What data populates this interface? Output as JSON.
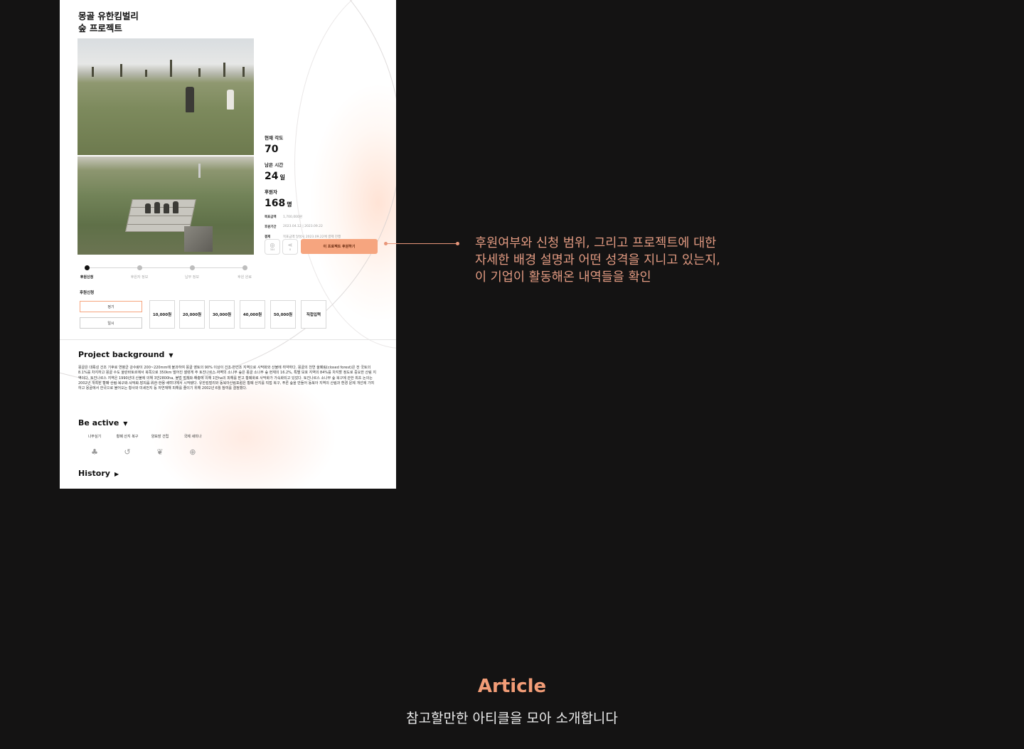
{
  "project": {
    "title_line1": "몽골 유한킴벌리",
    "title_line2": "숲 프로젝트"
  },
  "stats": [
    {
      "label": "현재 각도",
      "value": "70",
      "unit": ""
    },
    {
      "label": "남은 시간",
      "value": "24",
      "unit": "일"
    },
    {
      "label": "후원자",
      "value": "168",
      "unit": "명"
    }
  ],
  "info": [
    {
      "label": "목표금액",
      "value": "1,700,000원"
    },
    {
      "label": "후원기간",
      "value": "2023.04.12 | 2023.09.22"
    },
    {
      "label": "결제",
      "value": "목표금액 달성시 2023.09.22에 결제 진행"
    }
  ],
  "actions": {
    "like_count": "384",
    "share_count": "8",
    "support_button": "이 프로젝트 후원하기"
  },
  "steps": [
    {
      "label": "후원신청",
      "active": true
    },
    {
      "label": "후원자 정보",
      "active": false
    },
    {
      "label": "납부 정보",
      "active": false
    },
    {
      "label": "후원 완료",
      "active": false
    }
  ],
  "form": {
    "section_label": "후원신청",
    "types": [
      "정기",
      "일시"
    ],
    "amounts": [
      "10,000원",
      "20,000원",
      "30,000원",
      "40,000원",
      "50,000원",
      "직접입력"
    ]
  },
  "background": {
    "heading": "Project background",
    "arrow": "▼",
    "text": "몽골은 대륙성 건조 기후로 연평균 강수량이 200~220mm에 불과하여 몽골 영토의 90% 이상이 건조·반건조 지역으로 사막화와 산불에 취약하다. 몽골의 천연 울폐림(closed forest)은 전 국토의 8.1%를 차지하고 몽골 수도 울란바토르에서 북쪽으로 350km 떨어진 셀렝게 주 토진나르스 지역의 소나무 숲은 몽골 소나무 숲 현재의 16.2%, 특별 보호 지역의 84%를 차지할 정도로 중요한 산림 지역이다. 토진나르스 지역은 1990년대 산불에 의해 3만2800ha, 불법 벌채와 해충에 의해 1만ha의 피해를 받고 황폐화로 사막화가 가속화되고 있었다. 토진나르스 소나무 숲 복구에 관한 최초 논의는 2002년 개최된 황폐 산림 복구와 사막화 방지를 위한 한몽 세미나에서 시작됐다. 유한킴벌리와 동북아산림포럼은 황폐 산지를 직접 복구, 푸른 숲을 만들어 동북아 지역의 산림과 환경 문제 개선에 기여하고 몽골에서 한국으로 불어오는 황사와 미세먼지 등 자연재해 피해를 줄이기 위해 2002년 6월 참여를 결정했다."
  },
  "be_active": {
    "heading": "Be active",
    "arrow": "▼",
    "items": [
      {
        "label": "나무심기",
        "icon": "tree-icon",
        "glyph": "♣"
      },
      {
        "label": "황폐 산지 복구",
        "icon": "restore-icon",
        "glyph": "↺"
      },
      {
        "label": "양묘장 건립",
        "icon": "leaf-icon",
        "glyph": "❦"
      },
      {
        "label": "국제 세미나",
        "icon": "globe-icon",
        "glyph": "⊕"
      }
    ]
  },
  "history": {
    "heading": "History",
    "arrow": "▶"
  },
  "annotation": {
    "line1": "후원여부와 신청 범위, 그리고 프로젝트에 대한",
    "line2": "자세한 배경 설명과 어떤 성격을 지니고 있는지,",
    "line3": "이 기업이 활동해온 내역들을 확인"
  },
  "article": {
    "title": "Article",
    "subtitle": "참고할만한 아티클을 모아 소개합니다"
  },
  "colors": {
    "background": "#141313",
    "accent": "#f6a57f",
    "annotation": "#e39b82"
  }
}
